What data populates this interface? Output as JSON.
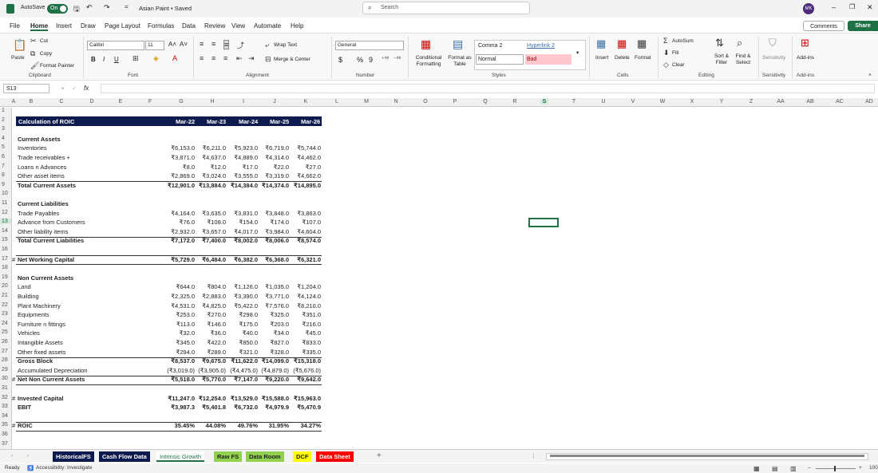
{
  "titlebar": {
    "autosave_label": "AutoSave",
    "autosave_state": "On",
    "doc_title": "Asian Paint • Saved",
    "search_placeholder": "Search",
    "user_initials": "MK",
    "qa_more": "="
  },
  "menu": [
    "File",
    "Home",
    "Insert",
    "Draw",
    "Page Layout",
    "Formulas",
    "Data",
    "Review",
    "View",
    "Automate",
    "Help"
  ],
  "menu_active": "Home",
  "comments_label": "Comments",
  "share_label": "Share",
  "ribbon": {
    "clipboard": {
      "paste": "Paste",
      "cut": "Cut",
      "copy": "Copy",
      "format_painter": "Format Painter",
      "group": "Clipboard"
    },
    "font": {
      "name": "Calibri",
      "size": "11",
      "group": "Font",
      "bold": "B",
      "italic": "I",
      "underline": "U"
    },
    "alignment": {
      "wrap": "Wrap Text",
      "merge": "Merge & Center",
      "group": "Alignment"
    },
    "number": {
      "format": "General",
      "group": "Number",
      "currency": "$",
      "percent": "%",
      "comma": "9"
    },
    "styles": {
      "conditional": "Conditional Formatting",
      "format_table": "Format as Table",
      "comma2": "Comma 2",
      "hyperlink2": "Hyperlink 2",
      "normal": "Normal",
      "bad": "Bad",
      "group": "Styles"
    },
    "cells": {
      "insert": "Insert",
      "delete": "Delete",
      "format": "Format",
      "group": "Cells"
    },
    "editing": {
      "autosum": "AutoSum",
      "fill": "Fill",
      "clear": "Clear",
      "sort": "Sort & Filter",
      "find": "Find & Select",
      "group": "Editing"
    },
    "sensitivity": {
      "label": "Sensitivity",
      "group": "Sensitivity"
    },
    "addins": {
      "label": "Add-ins",
      "group": "Add-ins"
    }
  },
  "formula_bar": {
    "name_box": "S13",
    "fx": "fx",
    "value": ""
  },
  "columns": [
    "A",
    "B",
    "C",
    "D",
    "E",
    "F",
    "G",
    "H",
    "I",
    "J",
    "K",
    "L",
    "M",
    "N",
    "O",
    "P",
    "Q",
    "R",
    "S",
    "T",
    "U",
    "V",
    "W",
    "X",
    "Y",
    "Z",
    "AA",
    "AB",
    "AC",
    "AD"
  ],
  "selected_column": "S",
  "sheet": {
    "title": "Calculation of ROIC",
    "years": [
      "Mar-22",
      "Mar-23",
      "Mar-24",
      "Mar-25",
      "Mar-26"
    ],
    "rows": [
      {
        "r": "4",
        "label": "Current Assets",
        "bold": true,
        "vals": []
      },
      {
        "r": "5",
        "label": "Inventories",
        "vals": [
          "₹6,153.0",
          "₹6,211.0",
          "₹5,923.0",
          "₹6,719.0",
          "₹5,744.0"
        ]
      },
      {
        "r": "6",
        "label": "Trade receivables +",
        "vals": [
          "₹3,871.0",
          "₹4,637.0",
          "₹4,889.0",
          "₹4,314.0",
          "₹4,462.0"
        ]
      },
      {
        "r": "7",
        "label": "Loans n Advances",
        "vals": [
          "₹8.0",
          "₹12.0",
          "₹17.0",
          "₹22.0",
          "₹27.0"
        ]
      },
      {
        "r": "8",
        "label": "Other asset items",
        "vals": [
          "₹2,869.0",
          "₹3,024.0",
          "₹3,555.0",
          "₹3,319.0",
          "₹4,662.0"
        ]
      },
      {
        "r": "9",
        "label": "Total Current Assets",
        "bold": true,
        "vals": [
          "₹12,901.0",
          "₹13,884.0",
          "₹14,384.0",
          "₹14,374.0",
          "₹14,895.0"
        ]
      },
      {
        "r": "11",
        "label": "Current Liabilities",
        "bold": true,
        "vals": []
      },
      {
        "r": "12",
        "label": "Trade Payables",
        "vals": [
          "₹4,164.0",
          "₹3,635.0",
          "₹3,831.0",
          "₹3,848.0",
          "₹3,863.0"
        ]
      },
      {
        "r": "13",
        "label": "Advance from Customers",
        "vals": [
          "₹76.0",
          "₹108.0",
          "₹154.0",
          "₹174.0",
          "₹107.0"
        ]
      },
      {
        "r": "14",
        "label": "Other liability items",
        "vals": [
          "₹2,932.0",
          "₹3,657.0",
          "₹4,017.0",
          "₹3,984.0",
          "₹4,604.0"
        ]
      },
      {
        "r": "15",
        "label": "Total Current Liabilities",
        "bold": true,
        "vals": [
          "₹7,172.0",
          "₹7,400.0",
          "₹8,002.0",
          "₹8,006.0",
          "₹8,574.0"
        ]
      },
      {
        "r": "17",
        "label": "Net Working Capital",
        "bold": true,
        "hash": "#",
        "vals": [
          "₹5,729.0",
          "₹6,484.0",
          "₹6,382.0",
          "₹6,368.0",
          "₹6,321.0"
        ]
      },
      {
        "r": "19",
        "label": "Non Current Assets",
        "bold": true,
        "vals": []
      },
      {
        "r": "20",
        "label": "Land",
        "vals": [
          "₹644.0",
          "₹804.0",
          "₹1,126.0",
          "₹1,035.0",
          "₹1,204.0"
        ]
      },
      {
        "r": "21",
        "label": "Building",
        "vals": [
          "₹2,325.0",
          "₹2,883.0",
          "₹3,390.0",
          "₹3,771.0",
          "₹4,124.0"
        ]
      },
      {
        "r": "22",
        "label": "Plant Machinery",
        "vals": [
          "₹4,531.0",
          "₹4,825.0",
          "₹5,422.0",
          "₹7,576.0",
          "₹8,210.0"
        ]
      },
      {
        "r": "23",
        "label": "Equipments",
        "vals": [
          "₹253.0",
          "₹270.0",
          "₹298.0",
          "₹325.0",
          "₹351.0"
        ]
      },
      {
        "r": "24",
        "label": "Furniture n fittings",
        "vals": [
          "₹113.0",
          "₹146.0",
          "₹175.0",
          "₹203.0",
          "₹216.0"
        ]
      },
      {
        "r": "25",
        "label": "Vehicles",
        "vals": [
          "₹32.0",
          "₹36.0",
          "₹40.0",
          "₹34.0",
          "₹45.0"
        ]
      },
      {
        "r": "26",
        "label": "Intangible Assets",
        "vals": [
          "₹345.0",
          "₹422.0",
          "₹850.0",
          "₹827.0",
          "₹833.0"
        ]
      },
      {
        "r": "27",
        "label": "Other fixed assets",
        "vals": [
          "₹294.0",
          "₹289.0",
          "₹321.0",
          "₹328.0",
          "₹335.0"
        ]
      },
      {
        "r": "28",
        "label": "Gross Block",
        "bold": true,
        "vals": [
          "₹8,537.0",
          "₹9,675.0",
          "₹11,622.0",
          "₹14,099.0",
          "₹15,318.0"
        ]
      },
      {
        "r": "29",
        "label": "Accumulated Depreciation",
        "vals": [
          "(₹3,019.0)",
          "(₹3,905.0)",
          "(₹4,475.0)",
          "(₹4,879.0)",
          "(₹5,676.0)"
        ]
      },
      {
        "r": "30",
        "label": "Net Non Current Assets",
        "bold": true,
        "hash": "#",
        "vals": [
          "₹5,518.0",
          "₹5,770.0",
          "₹7,147.0",
          "₹9,220.0",
          "₹9,642.0"
        ]
      },
      {
        "r": "32",
        "label": "Invested Capital",
        "bold": true,
        "hash": "#",
        "vals": [
          "₹11,247.0",
          "₹12,254.0",
          "₹13,529.0",
          "₹15,588.0",
          "₹15,963.0"
        ]
      },
      {
        "r": "33",
        "label": "EBIT",
        "bold": true,
        "vals": [
          "₹3,987.3",
          "₹5,401.8",
          "₹6,732.0",
          "₹4,979.9",
          "₹5,470.9"
        ]
      },
      {
        "r": "35",
        "label": "ROIC",
        "bold": true,
        "hash": "#",
        "vals": [
          "35.45%",
          "44.08%",
          "49.76%",
          "31.95%",
          "34.27%"
        ]
      }
    ]
  },
  "tabs": [
    {
      "label": "HistoricalFS",
      "bg": "#0d1a4e",
      "fg": "#ffffff"
    },
    {
      "label": "Cash Flow Data",
      "bg": "#0d1a4e",
      "fg": "#ffffff"
    },
    {
      "label": "Intrinsic Growth",
      "bg": "#ffffff",
      "fg": "#1e7145",
      "active": true
    },
    {
      "label": "Raw FS",
      "bg": "#92d050",
      "fg": "#222222"
    },
    {
      "label": "Data Room",
      "bg": "#92d050",
      "fg": "#222222"
    },
    {
      "label": "DCF",
      "bg": "#ffff00",
      "fg": "#222222"
    },
    {
      "label": "Data Sheet",
      "bg": "#ff0000",
      "fg": "#ffffff"
    }
  ],
  "add_sheet": "+",
  "status": {
    "ready": "Ready",
    "accessibility": "Accessibility: Investigate",
    "zoom": "100"
  }
}
